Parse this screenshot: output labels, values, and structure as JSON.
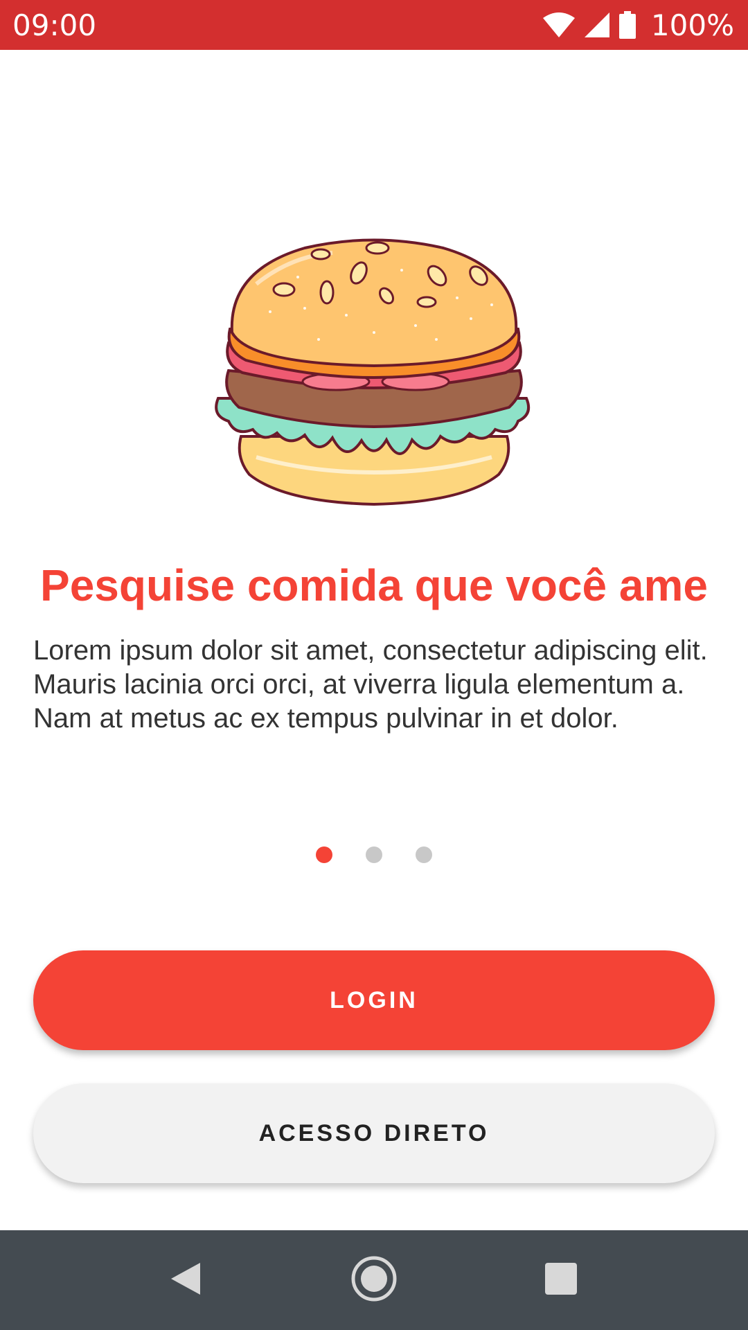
{
  "status_bar": {
    "time": "09:00",
    "battery_text": "100%",
    "icons": [
      "wifi-icon",
      "cell-signal-icon",
      "battery-icon"
    ],
    "background": "#d32f2f"
  },
  "onboarding": {
    "illustration": "hamburger-illustration",
    "title": "Pesquise comida que você ame",
    "description": "Lorem ipsum dolor sit amet, consectetur adipiscing elit. Mauris lacinia orci orci, at viverra ligula elementum a. Nam at metus ac ex tempus pulvinar in et dolor.",
    "page_indicator": {
      "total": 3,
      "active_index": 0
    },
    "accent_color": "#f44336"
  },
  "actions": {
    "login_label": "LOGIN",
    "direct_access_label": "ACESSO DIRETO"
  },
  "nav_bar": {
    "icons": [
      "back-icon",
      "home-icon",
      "recent-apps-icon"
    ],
    "background": "#444b51"
  }
}
